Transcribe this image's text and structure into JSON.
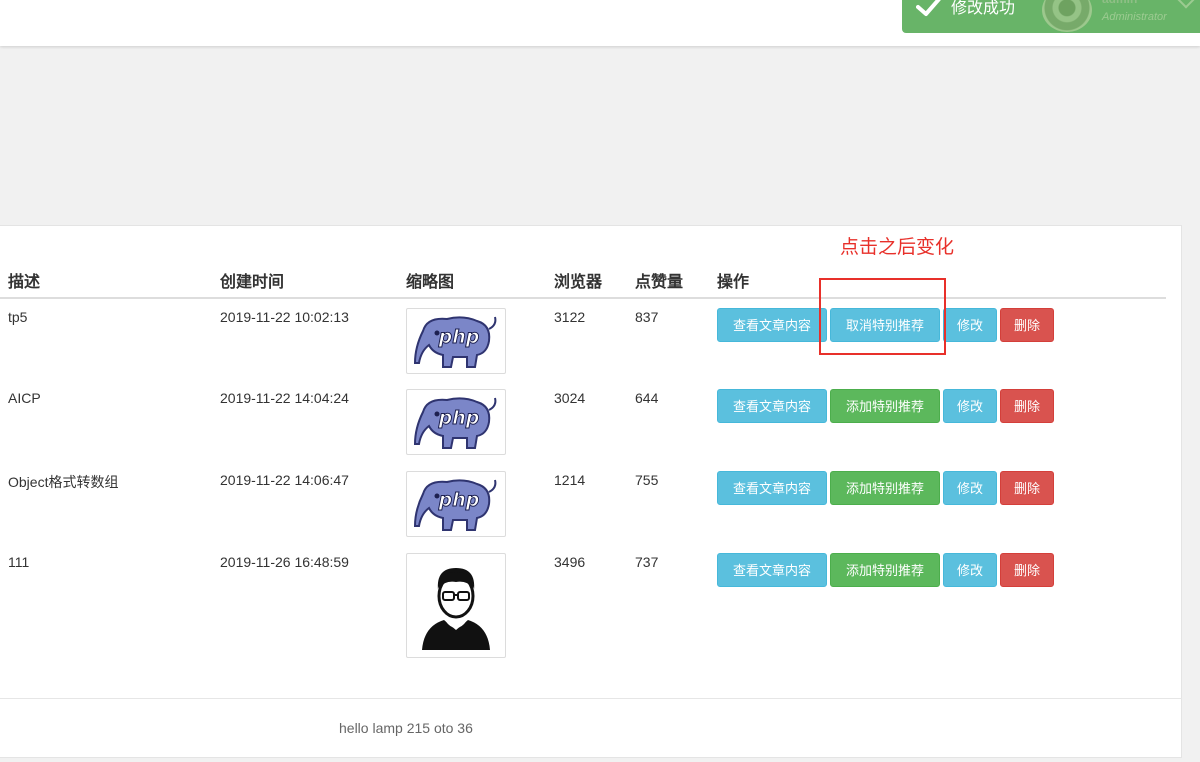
{
  "toast": {
    "message": "修改成功",
    "user_name": "admin",
    "user_role": "Administrator",
    "color": "#68b468"
  },
  "annotation": {
    "text": "点击之后变化",
    "color": "#e8302a"
  },
  "table": {
    "headers": {
      "desc": "描述",
      "time": "创建时间",
      "thumb": "缩略图",
      "views": "浏览器",
      "likes": "点赞量",
      "ops": "操作"
    },
    "rows": [
      {
        "desc": "tp5",
        "time": "2019-11-22 10:02:13",
        "thumb_icon": "php-elephant-icon",
        "views": "3122",
        "likes": "837",
        "view_btn": "查看文章内容",
        "rec_btn": "取消特别推荐",
        "rec_state": "recommended",
        "edit_btn": "修改",
        "del_btn": "删除"
      },
      {
        "desc": "AICP",
        "time": "2019-11-22 14:04:24",
        "thumb_icon": "php-elephant-icon",
        "views": "3024",
        "likes": "644",
        "view_btn": "查看文章内容",
        "rec_btn": "添加特别推荐",
        "rec_state": "not-recommended",
        "edit_btn": "修改",
        "del_btn": "删除"
      },
      {
        "desc": "Object格式转数组",
        "time": "2019-11-22 14:06:47",
        "thumb_icon": "php-elephant-icon",
        "views": "1214",
        "likes": "755",
        "view_btn": "查看文章内容",
        "rec_btn": "添加特别推荐",
        "rec_state": "not-recommended",
        "edit_btn": "修改",
        "del_btn": "删除"
      },
      {
        "desc": "111",
        "time": "2019-11-26 16:48:59",
        "thumb_icon": "person-avatar-icon",
        "views": "3496",
        "likes": "737",
        "view_btn": "查看文章内容",
        "rec_btn": "添加特别推荐",
        "rec_state": "not-recommended",
        "edit_btn": "修改",
        "del_btn": "删除"
      }
    ]
  },
  "footer": {
    "text": "hello lamp 215 oto 36"
  }
}
